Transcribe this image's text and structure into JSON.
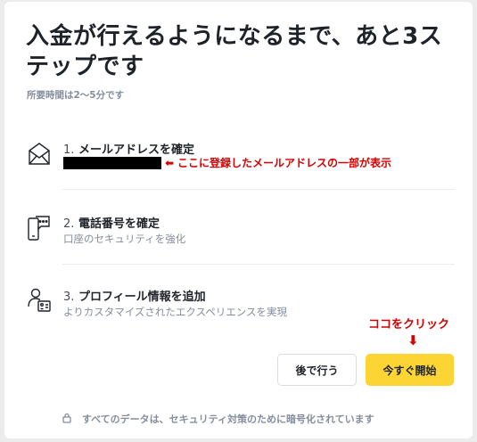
{
  "modal": {
    "title": "入金が行えるようになるまで、あと3ステップです",
    "subtitle": "所要時間は2〜5分です"
  },
  "steps": [
    {
      "number": "1.",
      "title": "メールアドレスを確定",
      "icon": "envelope-icon"
    },
    {
      "number": "2.",
      "title": "電話番号を確定",
      "description": "口座のセキュリティを強化",
      "icon": "phone-message-icon"
    },
    {
      "number": "3.",
      "title": "プロフィール情報を追加",
      "description": "よりカスタマイズされたエクスペリエンスを実現",
      "icon": "profile-id-icon"
    }
  ],
  "annotations": {
    "email_note": "ここに登録したメールアドレスの一部が表示",
    "click_note": "ココをクリック",
    "arrow_left": "⬅",
    "arrow_down": "⬇",
    "color": "#d50000"
  },
  "buttons": {
    "later": "後で行う",
    "start": "今すぐ開始",
    "start_color": "#fcd535"
  },
  "footer": {
    "text": "すべてのデータは、セキュリティ対策のために暗号化されています",
    "icon": "lock-icon"
  }
}
